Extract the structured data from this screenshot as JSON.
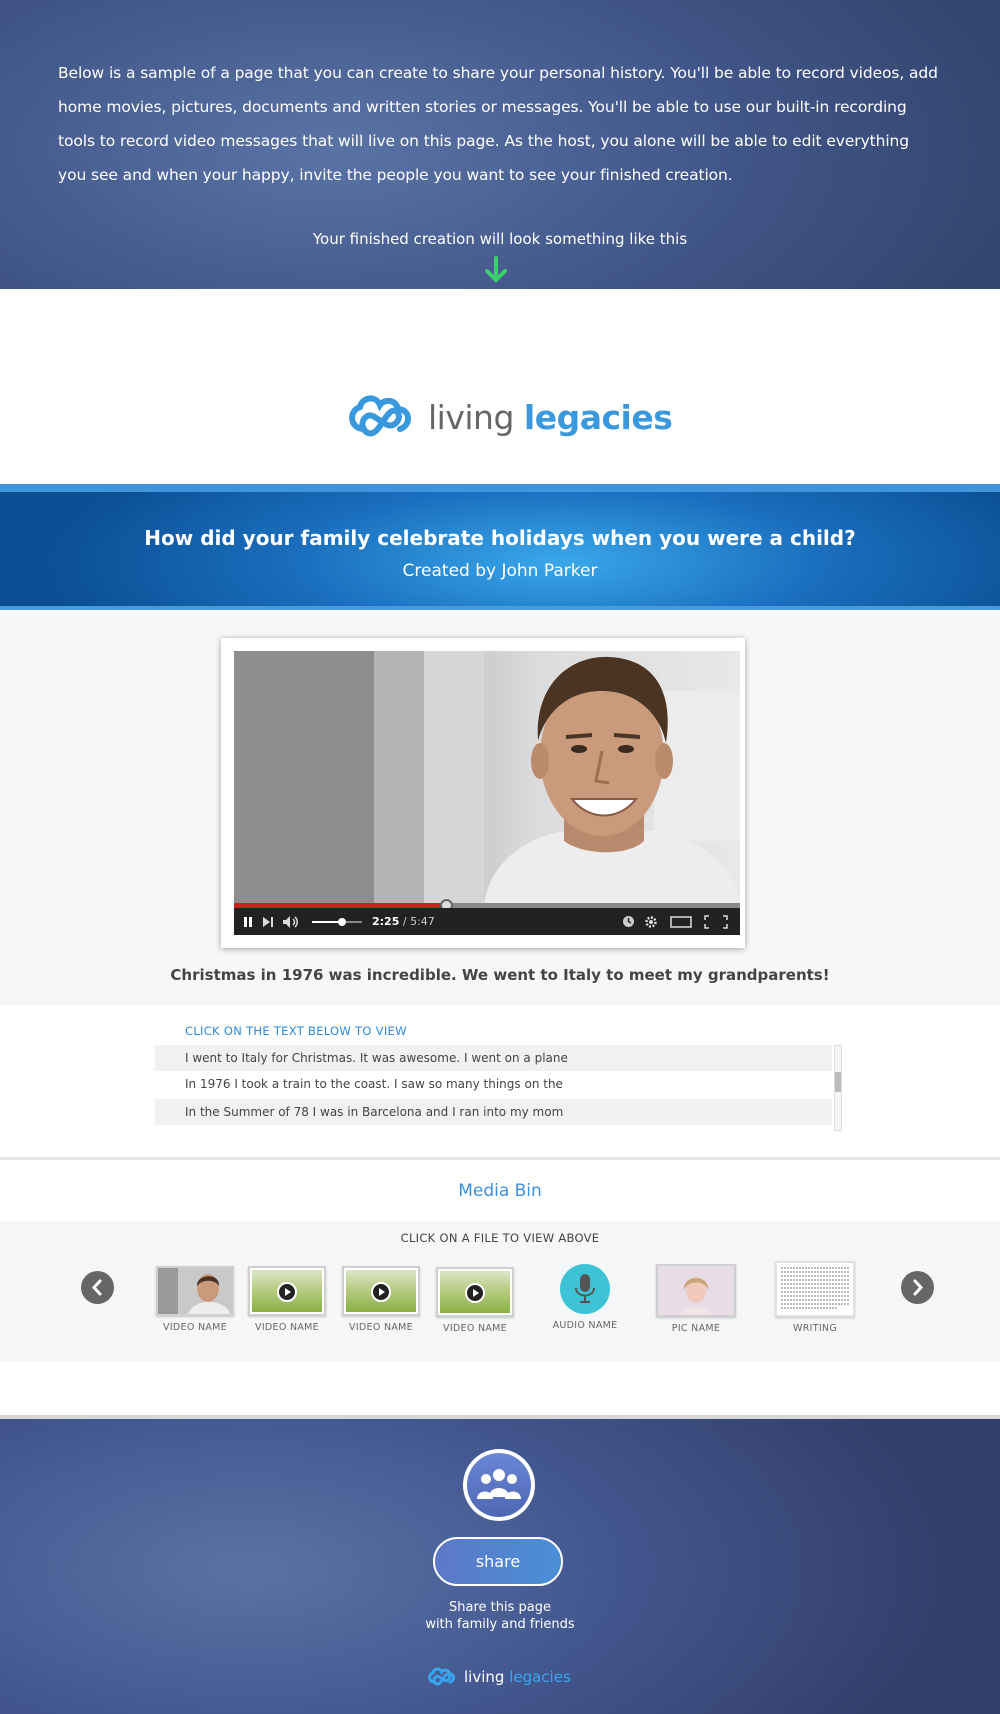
{
  "intro": {
    "text": "Below is a sample  of a page that you can create to share your personal history.  You'll be able to record videos, add home movies, pictures, documents and written stories or messages.  You'll be able to use our built-in recording tools to record video messages that will live on this page. As the host, you alone will be able to edit everything you see and when your happy, invite the people you want to see your finished creation.",
    "caption": "Your finished creation will look something like this"
  },
  "brand": {
    "name_part1": "living",
    "name_part2": "legacies"
  },
  "question": {
    "title": "How did your family celebrate holidays when you were a child?",
    "subtitle": "Created by John Parker"
  },
  "video": {
    "current_time": "2:25",
    "total_time": "/ 5:47",
    "progress_fraction": 0.418,
    "caption": "Christmas in 1976 was incredible. We went to Italy to meet my grandparents!"
  },
  "transcript": {
    "heading": "CLICK ON THE TEXT BELOW TO VIEW",
    "rows": [
      "I went to Italy for Christmas. It was awesome. I went on a plane",
      "In 1976 I took a train to the coast. I saw so many things on the",
      "In the Summer of 78 I was in Barcelona and I ran into my mom"
    ]
  },
  "media_bin": {
    "title": "Media Bin",
    "instruction": "CLICK ON A  FILE TO VIEW ABOVE",
    "items": [
      {
        "label": "VIDEO NAME"
      },
      {
        "label": "VIDEO NAME"
      },
      {
        "label": "VIDEO NAME"
      },
      {
        "label": "VIDEO NAME"
      },
      {
        "label": "AUDIO NAME"
      },
      {
        "label": "PIC NAME"
      },
      {
        "label": "WRITING"
      }
    ]
  },
  "footer": {
    "share_label": "share",
    "share_text_line1": "Share this page",
    "share_text_line2": "with family and friends"
  },
  "colors": {
    "brand_blue": "#3a98dd",
    "accent_green": "#3ccf6e",
    "progress_red": "#cc1f1f"
  }
}
